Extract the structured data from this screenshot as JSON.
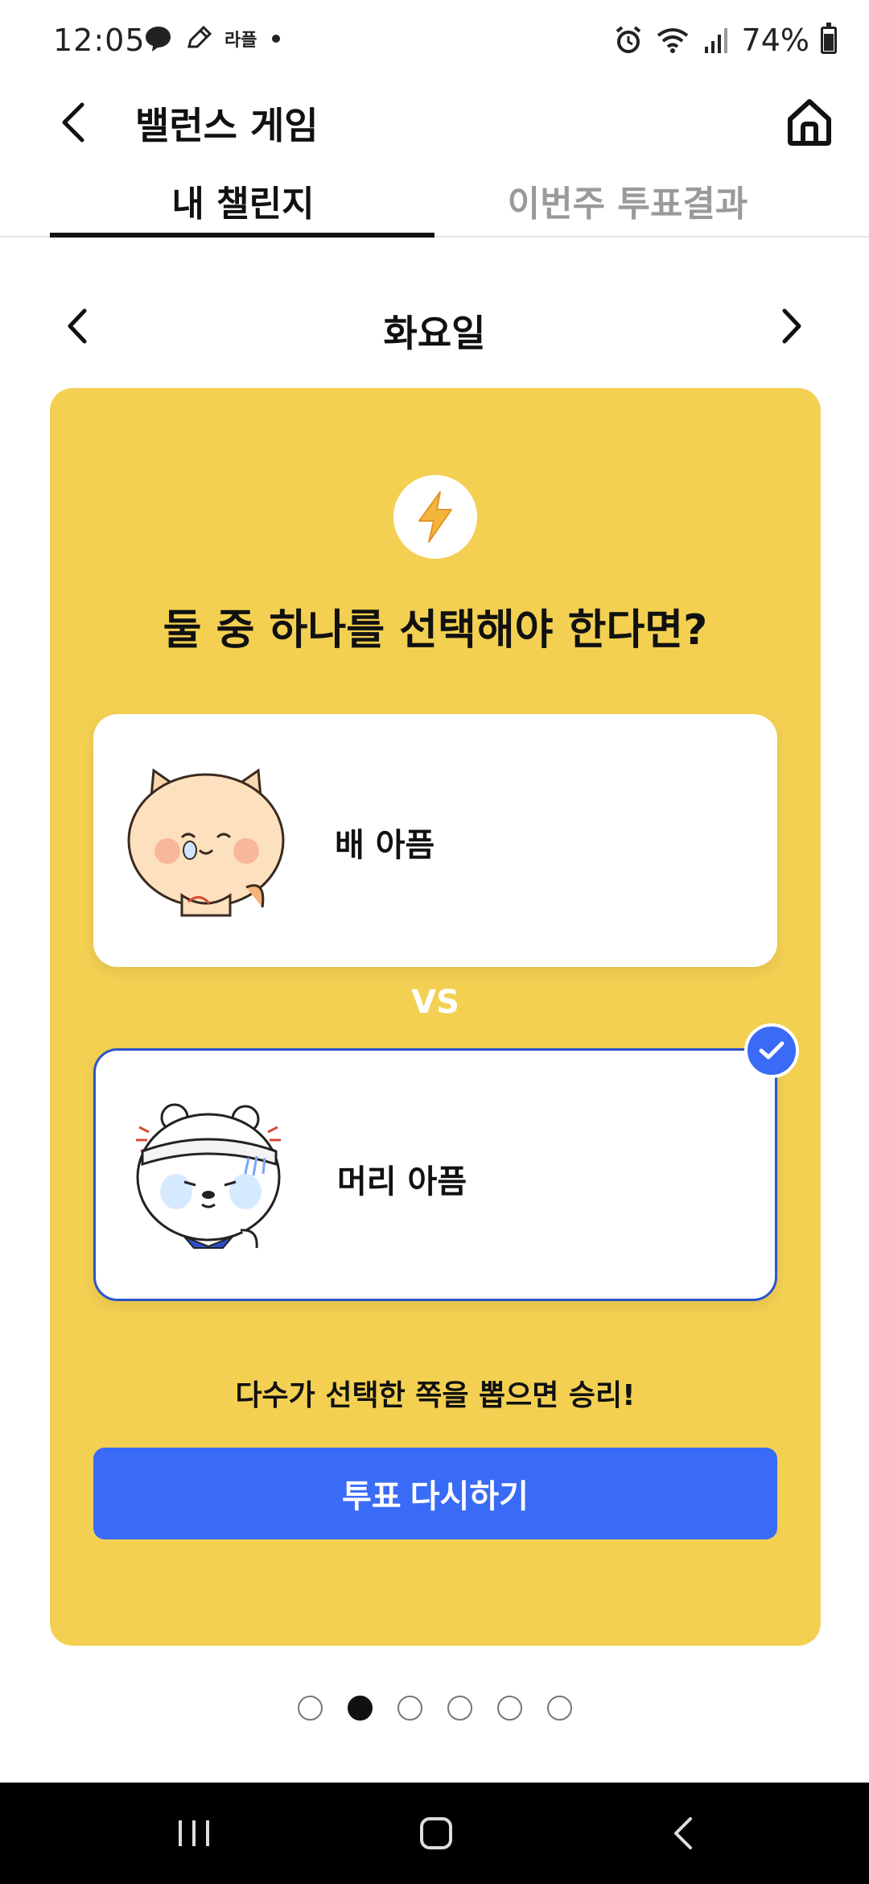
{
  "status_bar": {
    "time": "12:05",
    "notification_icons": [
      "chat-bubble-icon",
      "pencil-icon",
      "app-badge-icon",
      "dot-icon"
    ],
    "app_badge_text": "라플",
    "battery_text": "74%",
    "battery_level": 0.74
  },
  "header": {
    "title": "밸런스 게임"
  },
  "tabs": [
    {
      "label": "내 챌린지",
      "active": true
    },
    {
      "label": "이번주 투표결과",
      "active": false
    }
  ],
  "day_selector": {
    "label": "화요일"
  },
  "card": {
    "background_color": "#f3d052",
    "question": "둘 중 하나를 선택해야 한다면?",
    "options": [
      {
        "label": "배 아픔",
        "selected": false,
        "art": "crying-cat-illustration"
      },
      {
        "label": "머리 아픔",
        "selected": true,
        "art": "headache-bear-illustration"
      }
    ],
    "vs_label": "VS",
    "hint": "다수가 선택한 쪽을 뽑으면 승리!",
    "revote_button": "투표 다시하기"
  },
  "pagination": {
    "total": 6,
    "active_index": 1
  },
  "colors": {
    "accent": "#3a6bf6",
    "selected_border": "#2c54c9",
    "inactive_tab": "#9a9a9a"
  }
}
